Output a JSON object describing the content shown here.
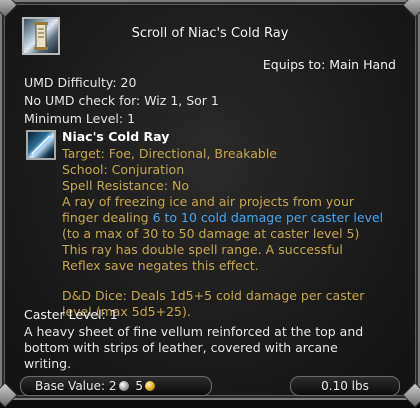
{
  "item": {
    "title": "Scroll of Niac's Cold Ray",
    "equips": "Equips to: Main Hand"
  },
  "stats": {
    "umd": "UMD Difficulty: 20",
    "no_umd": "No UMD check for: Wiz 1, Sor 1",
    "min_level": "Minimum Level: 1"
  },
  "spell": {
    "name": "Niac's Cold Ray",
    "target": "Target: Foe, Directional, Breakable",
    "school": "School: Conjuration",
    "resistance": "Spell Resistance: No",
    "desc_1": "A ray of freezing ice and air projects from your",
    "desc_2_pre": "finger dealing ",
    "desc_2_highlight": "6 to 10 cold damage per caster level",
    "desc_3": "(to a max of 30 to 50 damage at caster level 5)",
    "desc_4": "This ray has double spell range. A successful",
    "desc_5": "Reflex save negates this effect.",
    "dice_1": "D&D Dice: Deals 1d5+5 cold damage per caster",
    "dice_2": "level (max 5d5+25)."
  },
  "caster_level": "Caster Level: 1",
  "description": [
    "A heavy sheet of fine vellum reinforced at the top and",
    "bottom with strips of leather, covered with arcane",
    "writing."
  ],
  "footer": {
    "base_value_label": "Base Value:",
    "silver": "2",
    "gold": "5",
    "weight": "0.10 lbs"
  },
  "icons": {
    "item": "scroll-icon",
    "spell": "cold-ray-icon",
    "silver_coin": "silver-coin-icon",
    "gold_coin": "gold-coin-icon"
  },
  "colors": {
    "spell_text": "#c8a64e",
    "highlight": "#47a6f0",
    "text": "#e6e6e6"
  }
}
